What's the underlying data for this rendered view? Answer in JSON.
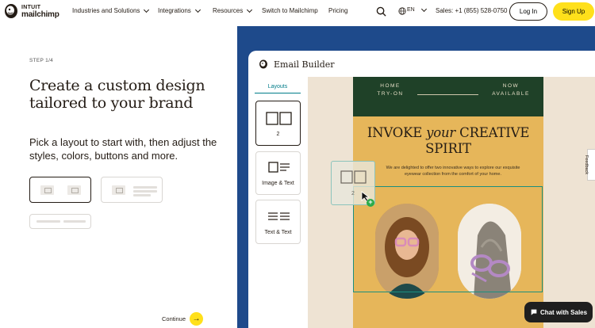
{
  "nav": {
    "logo_top": "INTUIT",
    "logo_bottom": "mailchimp",
    "items": [
      {
        "label": "Industries and Solutions"
      },
      {
        "label": "Integrations"
      },
      {
        "label": "Resources"
      },
      {
        "label": "Switch to Mailchimp"
      },
      {
        "label": "Pricing"
      }
    ],
    "language": "EN",
    "sales": "Sales: +1 (855) 528-0750",
    "login": "Log In",
    "signup": "Sign Up"
  },
  "left": {
    "step": "STEP 1/4",
    "headline": "Create a custom design tailored to your brand",
    "subhead": "Pick a layout to start with, then adjust the styles, colors, buttons and more.",
    "continue": "Continue",
    "continue_arrow": "→"
  },
  "builder": {
    "title": "Email Builder",
    "layouts_tab": "Layouts",
    "cards": [
      {
        "label": "2"
      },
      {
        "label": "Image & Text"
      },
      {
        "label": "Text & Text"
      }
    ],
    "drag_label": "2"
  },
  "email": {
    "top_left": "HOME\nTRY-ON",
    "top_right": "NOW\nAVAILABLE",
    "title_pre": "INVOKE ",
    "title_italic": "your",
    "title_post": " CREATIVE SPIRIT",
    "description": "We are delighted to offer two innovative ways to explore our exquisite eyewear collection from the comfort of your home."
  },
  "feedback": "Feedback",
  "chat": "Chat with Sales",
  "colors": {
    "brand_yellow": "#ffe01b",
    "panel_blue": "#1e4a8b",
    "email_green": "#1f4128",
    "email_mustard": "#e6b65a",
    "accent_teal": "#007c89"
  }
}
